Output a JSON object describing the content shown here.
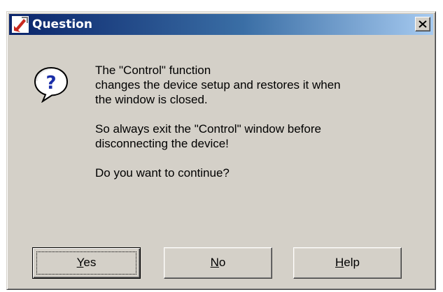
{
  "window": {
    "title": "Question",
    "app_icon": "red-arrow-app-icon",
    "close_glyph": "×"
  },
  "dialog": {
    "icon": "question-bubble-icon",
    "icon_glyph": "?",
    "message": [
      "The \"Control\" function\nchanges the device setup and restores it when\nthe window is closed.",
      "So always exit the \"Control\" window before\ndisconnecting the device!",
      "Do you want to continue?"
    ]
  },
  "buttons": {
    "yes": {
      "accel": "Y",
      "rest": "es"
    },
    "no": {
      "accel": "N",
      "rest": "o"
    },
    "help": {
      "accel": "H",
      "rest": "elp"
    }
  },
  "colors": {
    "dialog_face": "#d4d0c8",
    "title_gradient_start": "#0a246a",
    "title_gradient_end": "#a6caf0",
    "question_mark": "#1a2ea8"
  }
}
